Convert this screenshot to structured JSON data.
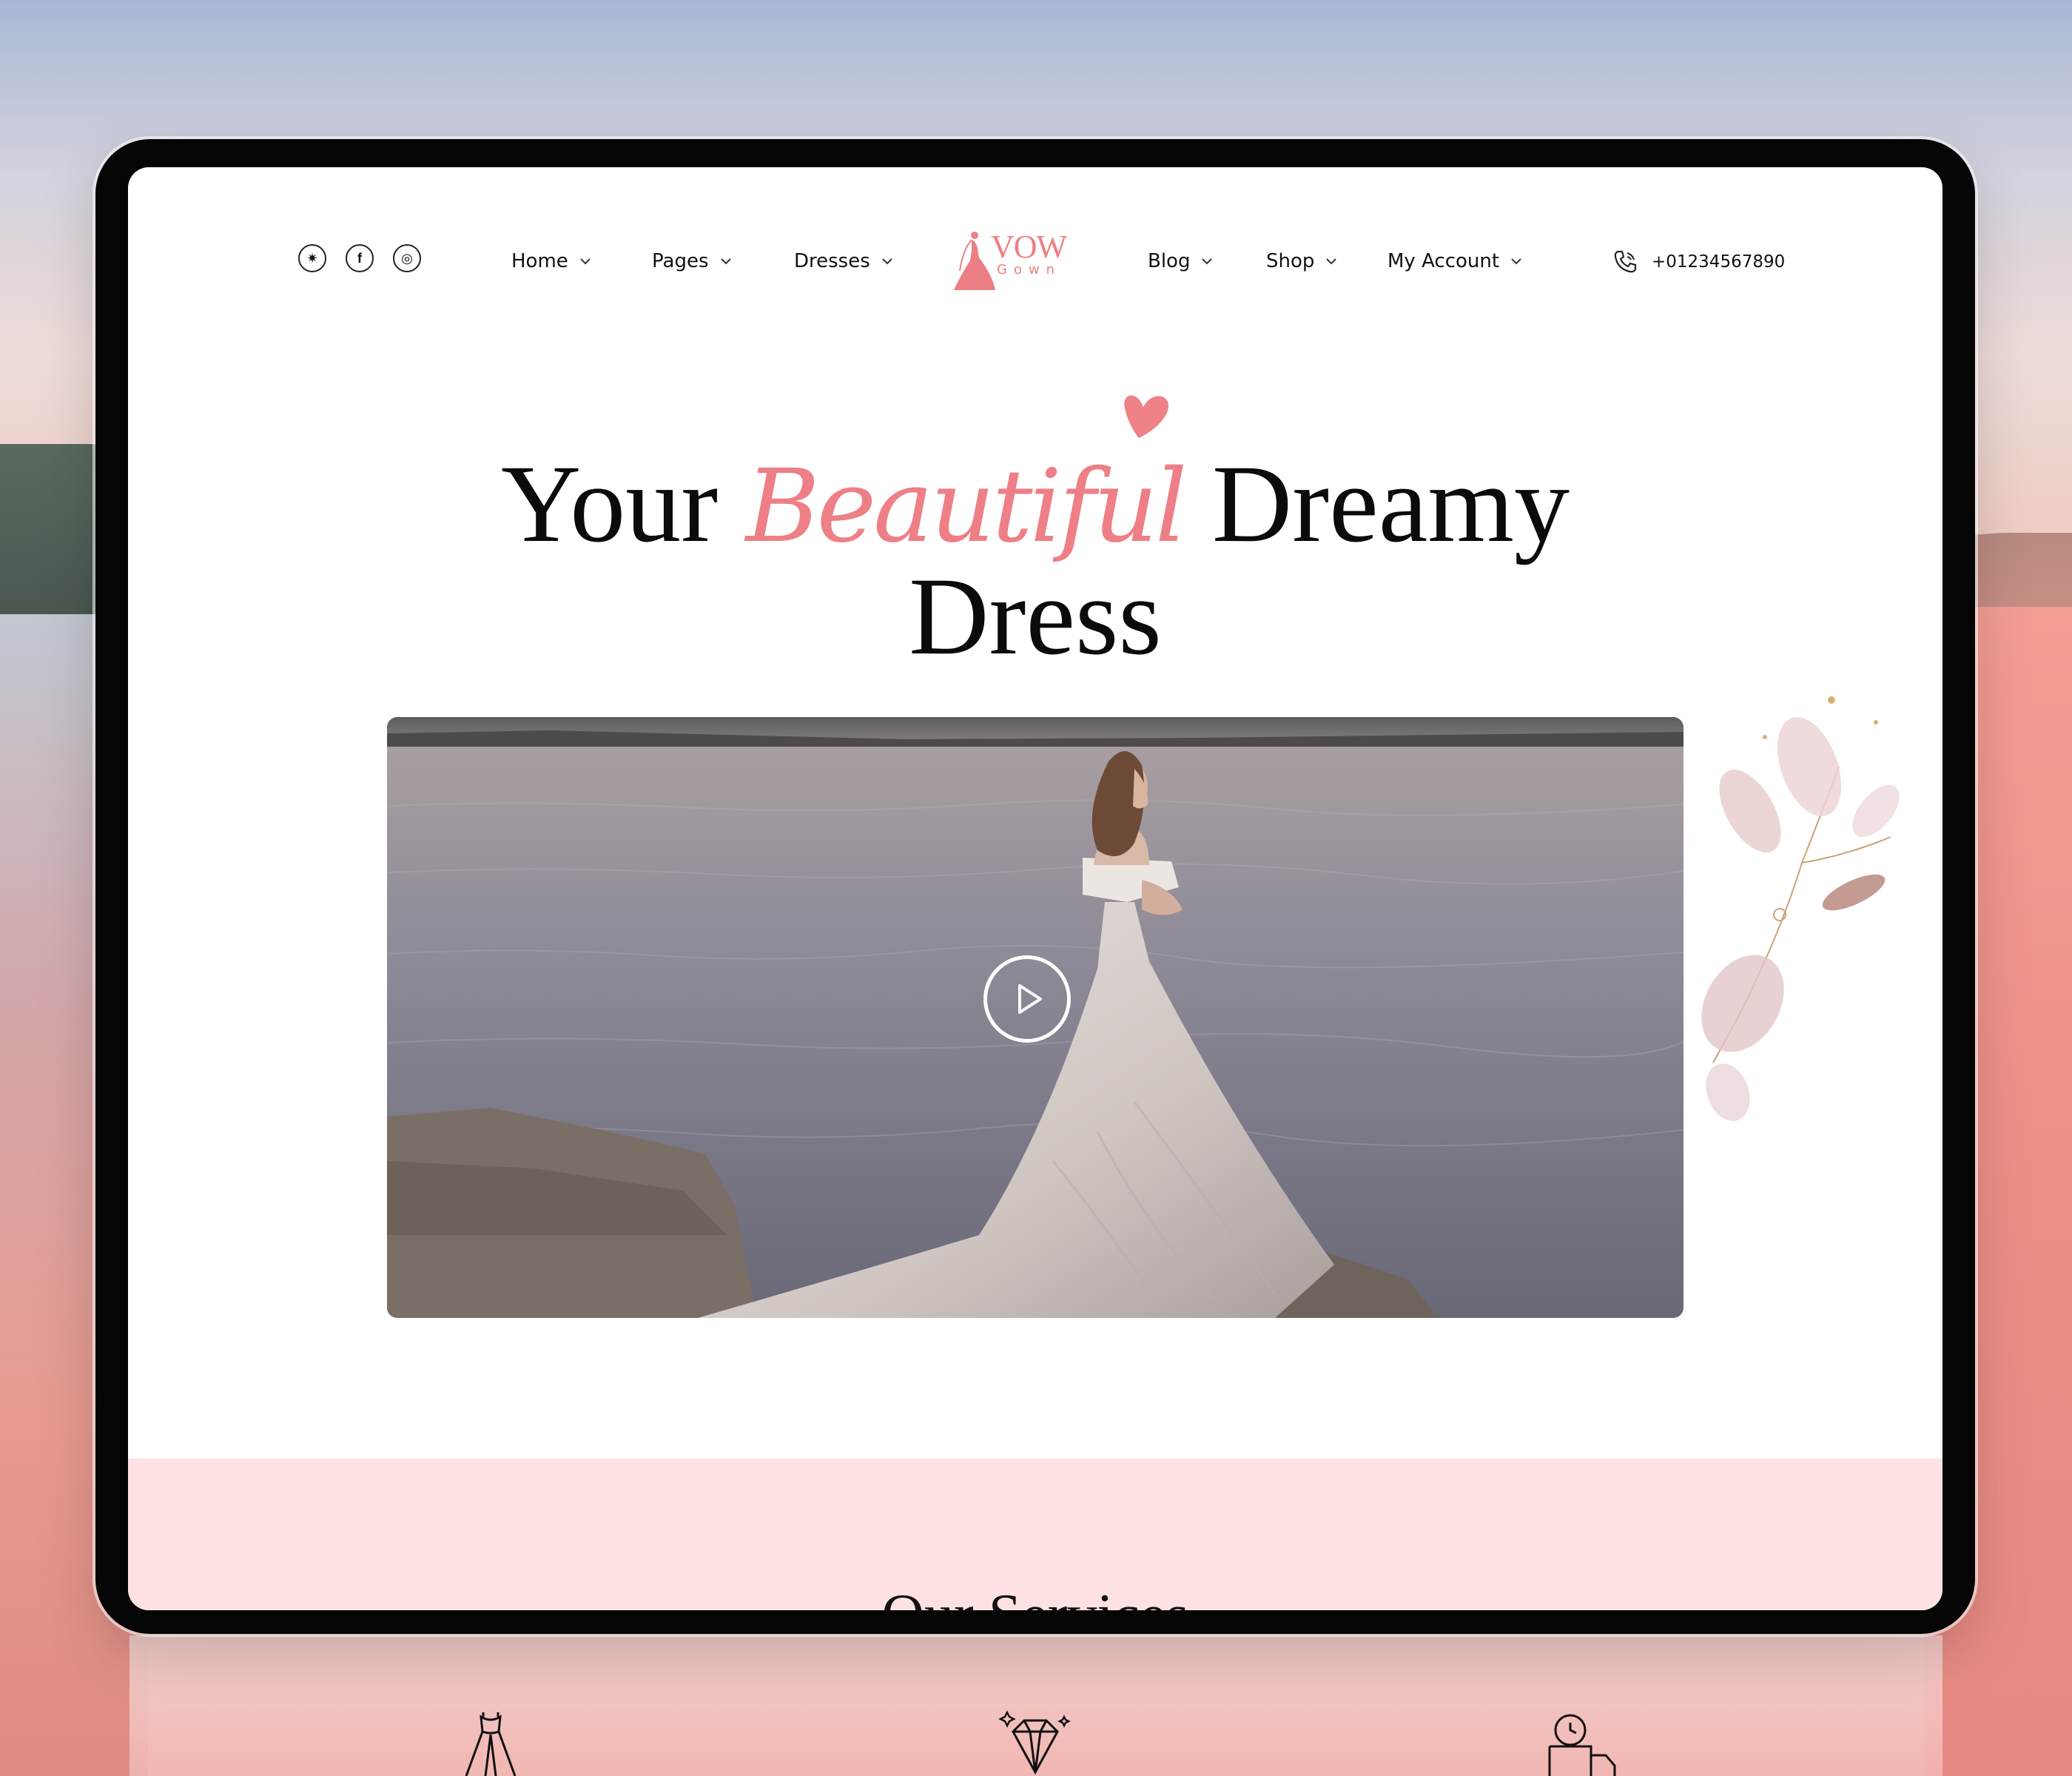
{
  "header": {
    "social": [
      {
        "name": "twitter",
        "icon": "twitter-icon",
        "glyph": "✷"
      },
      {
        "name": "facebook",
        "icon": "facebook-icon",
        "glyph": "f"
      },
      {
        "name": "instagram",
        "icon": "instagram-icon",
        "glyph": "◎"
      }
    ],
    "nav_left": [
      {
        "label": "Home"
      },
      {
        "label": "Pages"
      },
      {
        "label": "Dresses"
      }
    ],
    "logo": {
      "top": "VOW",
      "bottom": "Gown"
    },
    "nav_right": [
      {
        "label": "Blog"
      },
      {
        "label": "Shop"
      },
      {
        "label": "My Account"
      }
    ],
    "phone": "+01234567890"
  },
  "hero": {
    "title_part1": "Your ",
    "title_accent": "Beautiful",
    "title_part2": " Dreamy",
    "title_line2": "Dress"
  },
  "services": {
    "title": "Our Services"
  },
  "colors": {
    "accent": "#ee7f86",
    "services_bg": "#fde1e3",
    "text": "#0b0b0b"
  }
}
